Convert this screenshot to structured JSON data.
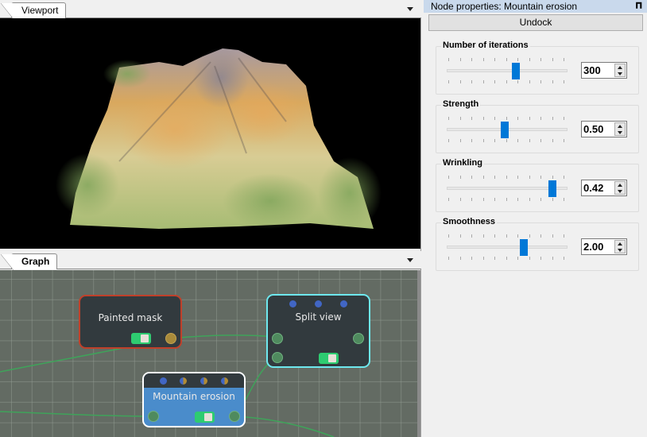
{
  "viewport": {
    "tab_label": "Viewport",
    "dropdown_icon": "chevron-down-icon",
    "scene": "3D rendered eroded mountain terrain"
  },
  "graph": {
    "tab_label": "Graph",
    "dropdown_icon": "chevron-down-icon",
    "nodes": [
      {
        "id": "painted-mask",
        "title": "Painted mask",
        "border_color": "#c0402a",
        "enabled": true,
        "outputs": 1,
        "output_color": "#a88a3a"
      },
      {
        "id": "split-view",
        "title": "Split view",
        "border_color": "#6ee8ee",
        "enabled": true,
        "inputs": 2,
        "outputs": 1,
        "param_dots": 3
      },
      {
        "id": "mountain-erosion",
        "title": "Mountain erosion",
        "border_color": "#ffffff",
        "fill_color": "#4a8ccb",
        "enabled": true,
        "inputs": 1,
        "outputs": 1,
        "param_dots": 4,
        "selected": true
      }
    ],
    "link_color": "#3fa35a"
  },
  "properties": {
    "title": "Node properties: Mountain erosion",
    "pin_icon": "pin-icon",
    "undock_label": "Undock",
    "accent": "#0078d7",
    "params": [
      {
        "label": "Number of iterations",
        "value": "300",
        "slider_fraction": 0.58
      },
      {
        "label": "Strength",
        "value": "0.50",
        "slider_fraction": 0.48
      },
      {
        "label": "Wrinkling",
        "value": "0.42",
        "slider_fraction": 0.9
      },
      {
        "label": "Smoothness",
        "value": "2.00",
        "slider_fraction": 0.65
      }
    ]
  }
}
